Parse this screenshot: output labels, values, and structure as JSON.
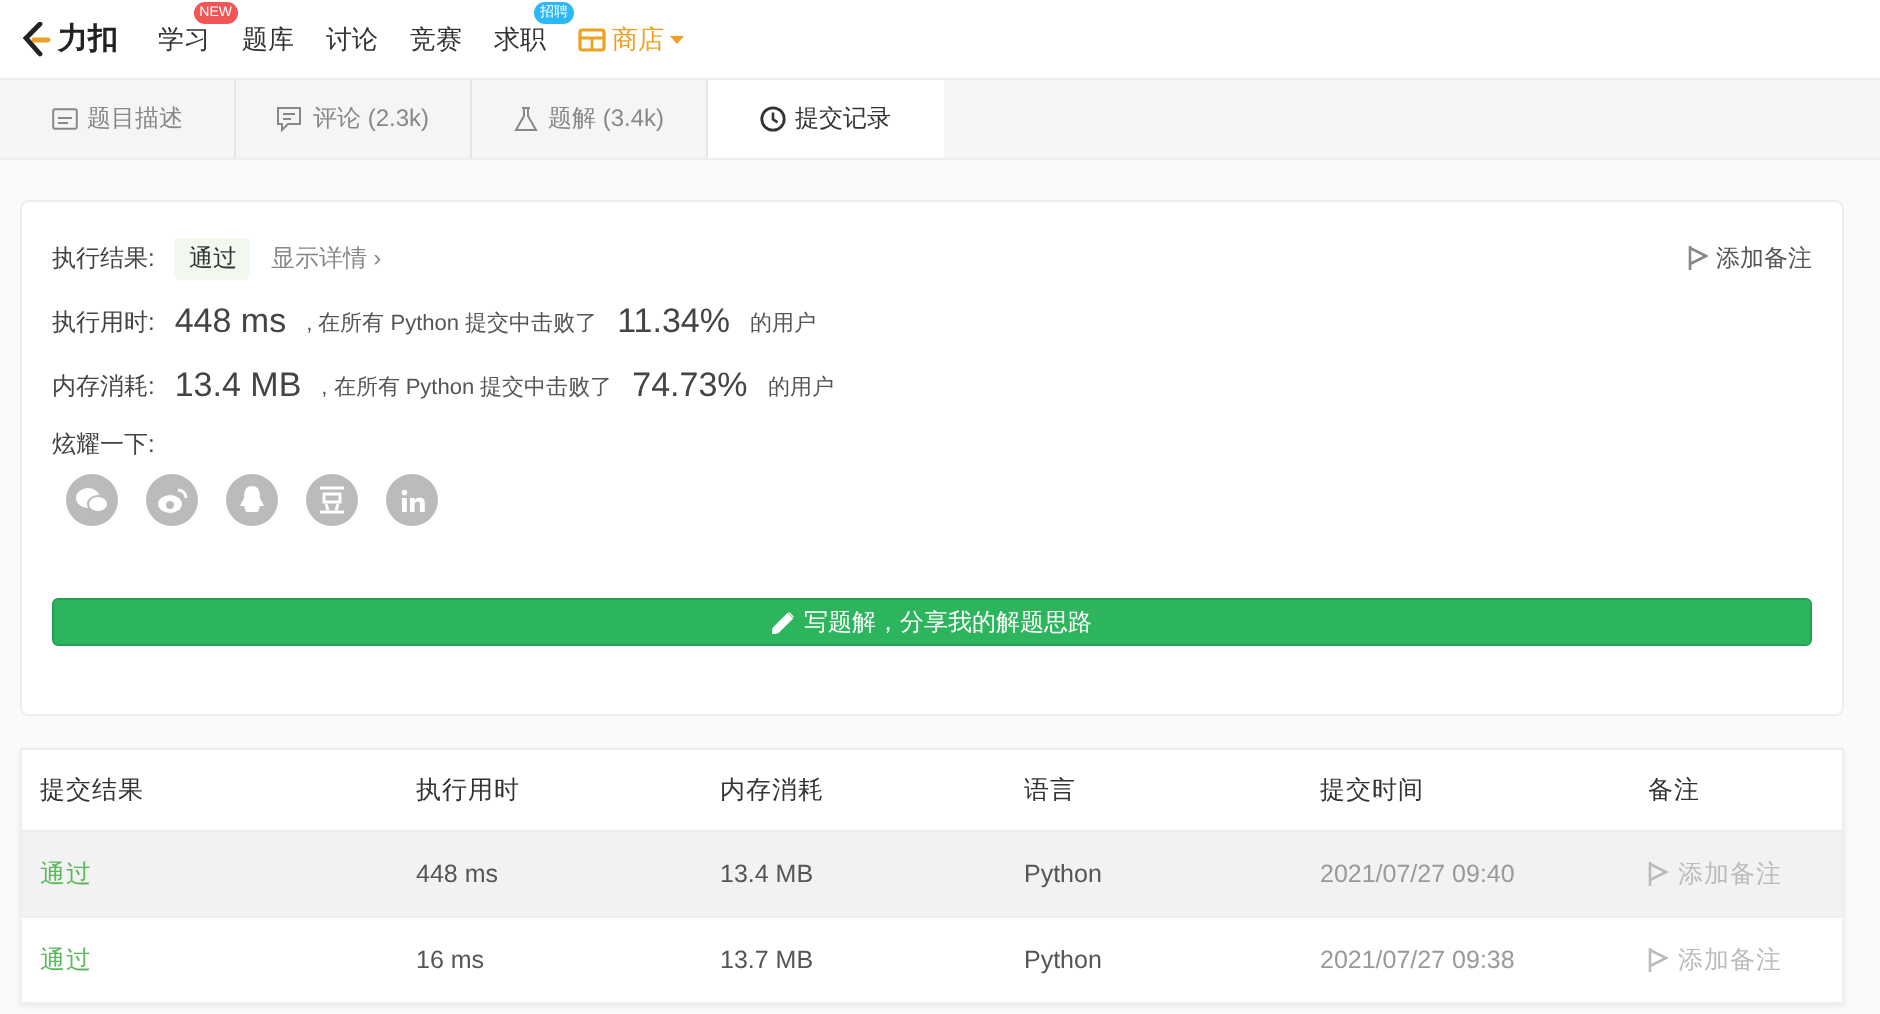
{
  "logo": {
    "text": "力扣"
  },
  "nav": [
    {
      "label": "学习",
      "kind": "link",
      "badge": {
        "text": "NEW",
        "color": "#f05656"
      }
    },
    {
      "label": "题库",
      "kind": "link"
    },
    {
      "label": "讨论",
      "kind": "link"
    },
    {
      "label": "竞赛",
      "kind": "link"
    },
    {
      "label": "求职",
      "kind": "link",
      "badge": {
        "text": "招聘",
        "color": "#2db7f5"
      }
    },
    {
      "label": "商店",
      "kind": "shop"
    }
  ],
  "tabs": [
    {
      "label": "题目描述",
      "selected": false
    },
    {
      "label": "评论 (2.3k)",
      "selected": false
    },
    {
      "label": "题解 (3.4k)",
      "selected": false
    },
    {
      "label": "提交记录",
      "selected": true
    }
  ],
  "result": {
    "label": "执行结果:",
    "status": "通过",
    "details_link": "显示详情 ›",
    "add_note": "添加备注"
  },
  "stats": [
    {
      "label": "执行用时:",
      "value": "448 ms",
      "middle": ", 在所有 Python 提交中击败了",
      "percent": "11.34%",
      "suffix": "的用户"
    },
    {
      "label": "内存消耗:",
      "value": "13.4 MB",
      "middle": ", 在所有 Python 提交中击败了",
      "percent": "74.73%",
      "suffix": "的用户"
    }
  ],
  "share": {
    "label": "炫耀一下:"
  },
  "write_button": "写题解，分享我的解题思路",
  "table": {
    "columns": [
      "提交结果",
      "执行用时",
      "内存消耗",
      "语言",
      "提交时间",
      "备注"
    ],
    "rows": [
      {
        "status": "通过",
        "runtime": "448 ms",
        "memory": "13.4 MB",
        "language": "Python",
        "time": "2021/07/27 09:40",
        "note": "添加备注",
        "highlighted": true
      },
      {
        "status": "通过",
        "runtime": "16 ms",
        "memory": "13.7 MB",
        "language": "Python",
        "time": "2021/07/27 09:38",
        "note": "添加备注",
        "highlighted": false
      }
    ]
  }
}
